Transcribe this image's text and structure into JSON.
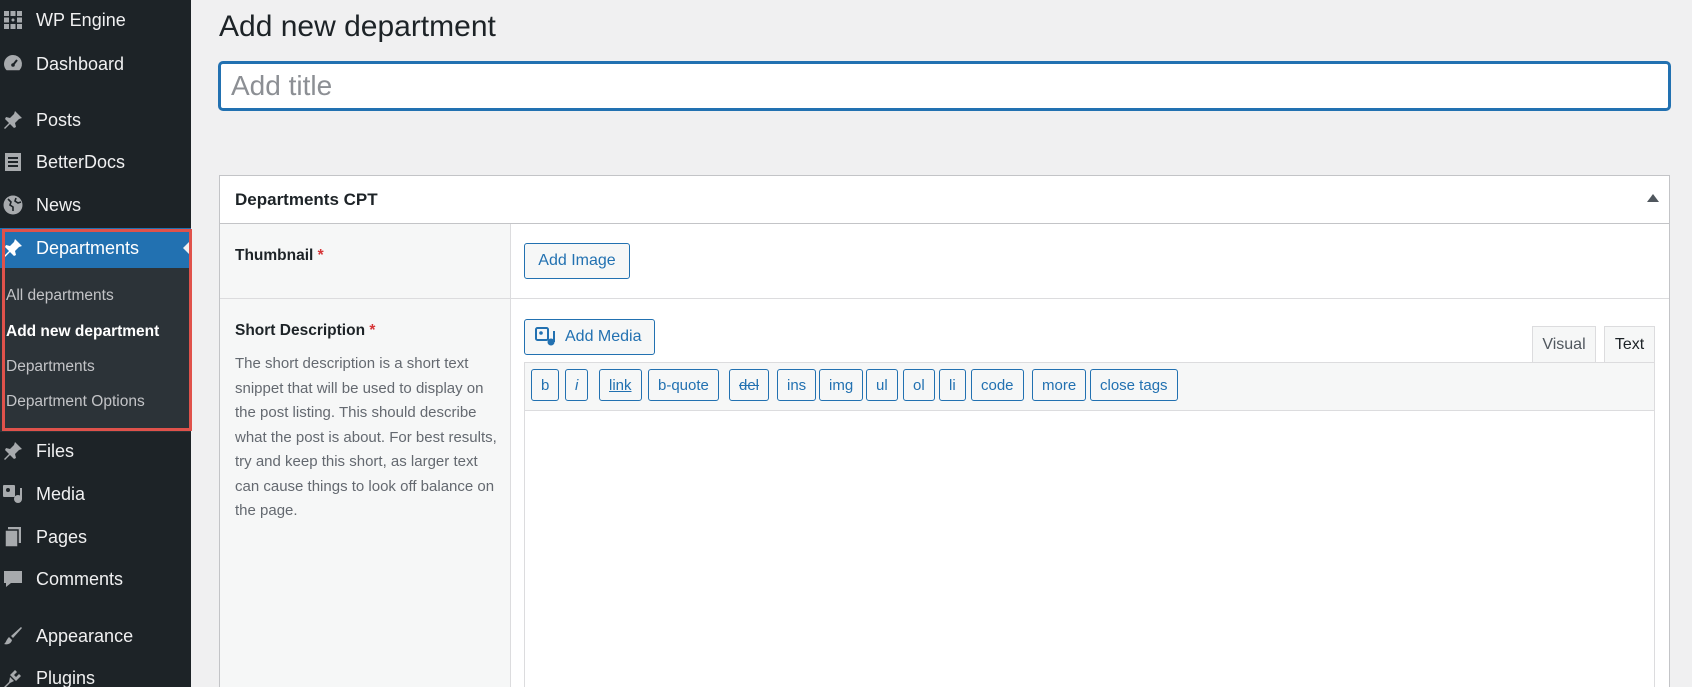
{
  "sidebar": {
    "items": [
      {
        "label": "WP Engine",
        "icon": "wp-engine-icon"
      },
      {
        "label": "Dashboard",
        "icon": "dashboard-icon"
      },
      {
        "label": "Posts",
        "icon": "pin-icon"
      },
      {
        "label": "BetterDocs",
        "icon": "docs-icon"
      },
      {
        "label": "News",
        "icon": "globe-icon"
      },
      {
        "label": "Departments",
        "icon": "pin-icon"
      },
      {
        "label": "Files",
        "icon": "pin-icon"
      },
      {
        "label": "Media",
        "icon": "media-icon"
      },
      {
        "label": "Pages",
        "icon": "pages-icon"
      },
      {
        "label": "Comments",
        "icon": "comment-icon"
      },
      {
        "label": "Appearance",
        "icon": "brush-icon"
      },
      {
        "label": "Plugins",
        "icon": "plugin-icon"
      }
    ],
    "submenu": [
      {
        "label": "All departments"
      },
      {
        "label": "Add new department"
      },
      {
        "label": "Departments"
      },
      {
        "label": "Department Options"
      }
    ]
  },
  "main": {
    "page_title": "Add new department",
    "title_placeholder": "Add title",
    "metabox": {
      "title": "Departments CPT",
      "thumbnail_label": "Thumbnail",
      "required_mark": "*",
      "add_image_label": "Add Image",
      "short_description_label": "Short Description",
      "short_description_help": "The short description is a short text snippet that will be used to display on the post listing. This should describe what the post is about. For best results, try and keep this short, as larger text can cause things to look off balance on the page.",
      "add_media_label": "Add Media",
      "tabs": [
        {
          "label": "Visual"
        },
        {
          "label": "Text"
        }
      ],
      "quicktags": [
        {
          "label": "b"
        },
        {
          "label": "i"
        },
        {
          "label": "link"
        },
        {
          "label": "b-quote"
        },
        {
          "label": "del"
        },
        {
          "label": "ins"
        },
        {
          "label": "img"
        },
        {
          "label": "ul"
        },
        {
          "label": "ol"
        },
        {
          "label": "li"
        },
        {
          "label": "code"
        },
        {
          "label": "more"
        },
        {
          "label": "close tags"
        }
      ]
    }
  },
  "colors": {
    "sidebar_bg": "#1d2327",
    "active_item": "#2271b1",
    "highlight_border": "#e0524b",
    "required": "#d63638"
  }
}
